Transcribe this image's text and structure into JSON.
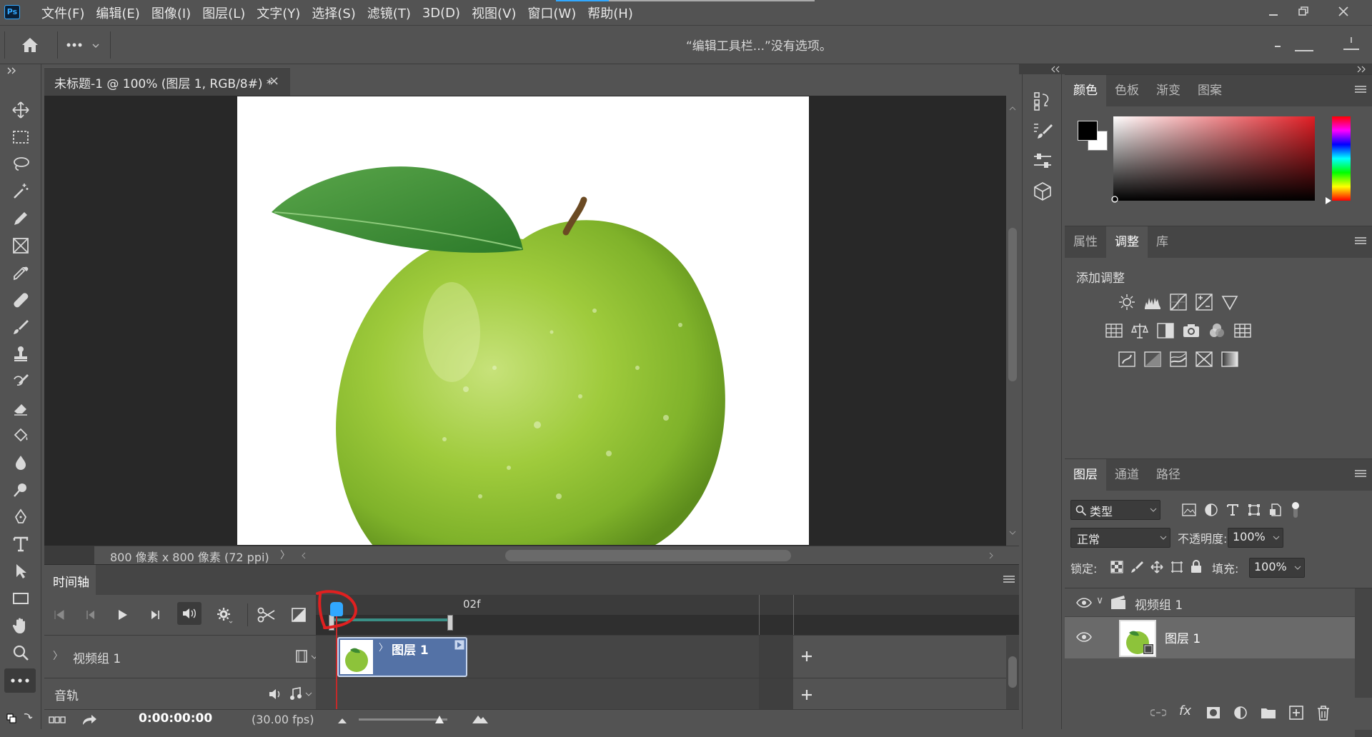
{
  "app": {
    "logo": "Ps"
  },
  "menu": [
    "文件(F)",
    "编辑(E)",
    "图像(I)",
    "图层(L)",
    "文字(Y)",
    "选择(S)",
    "滤镜(T)",
    "3D(D)",
    "视图(V)",
    "窗口(W)",
    "帮助(H)"
  ],
  "options_bar": {
    "message": "“编辑工具栏...”没有选项。"
  },
  "document": {
    "tab_title": "未标题-1 @ 100% (图层 1, RGB/8#) *",
    "close": "×",
    "status": "800 像素 x 800 像素 (72 ppi)",
    "status_arrow": "〉"
  },
  "timeline": {
    "title": "时间轴",
    "frame_label": "02f",
    "video_group": "视频组 1",
    "audio_track": "音轨",
    "clip_label": "图层 1",
    "timecode": "0:00:00:00",
    "fps": "(30.00 fps)",
    "expand": "〉",
    "clip_expand": "〉"
  },
  "color_panel": {
    "tabs": [
      "颜色",
      "色板",
      "渐变",
      "图案"
    ],
    "active": 0,
    "fg": "#000000",
    "bg": "#ffffff"
  },
  "adjust_panel": {
    "tabs": [
      "属性",
      "调整",
      "库"
    ],
    "active": 1,
    "heading": "添加调整"
  },
  "layers_panel": {
    "tabs": [
      "图层",
      "通道",
      "路径"
    ],
    "active": 0,
    "filter_kind": "类型",
    "blend_mode": "正常",
    "opacity_label": "不透明度:",
    "opacity": "100%",
    "lock_label": "锁定:",
    "fill_label": "填充:",
    "fill": "100%",
    "group_name": "视频组 1",
    "layer_name": "图层 1",
    "group_expand": "∨"
  },
  "colors": {
    "accent": "#31a8ff",
    "clip": "#5472a6",
    "annotation": "#e02020",
    "panel": "#535353",
    "dark": "#282828"
  }
}
